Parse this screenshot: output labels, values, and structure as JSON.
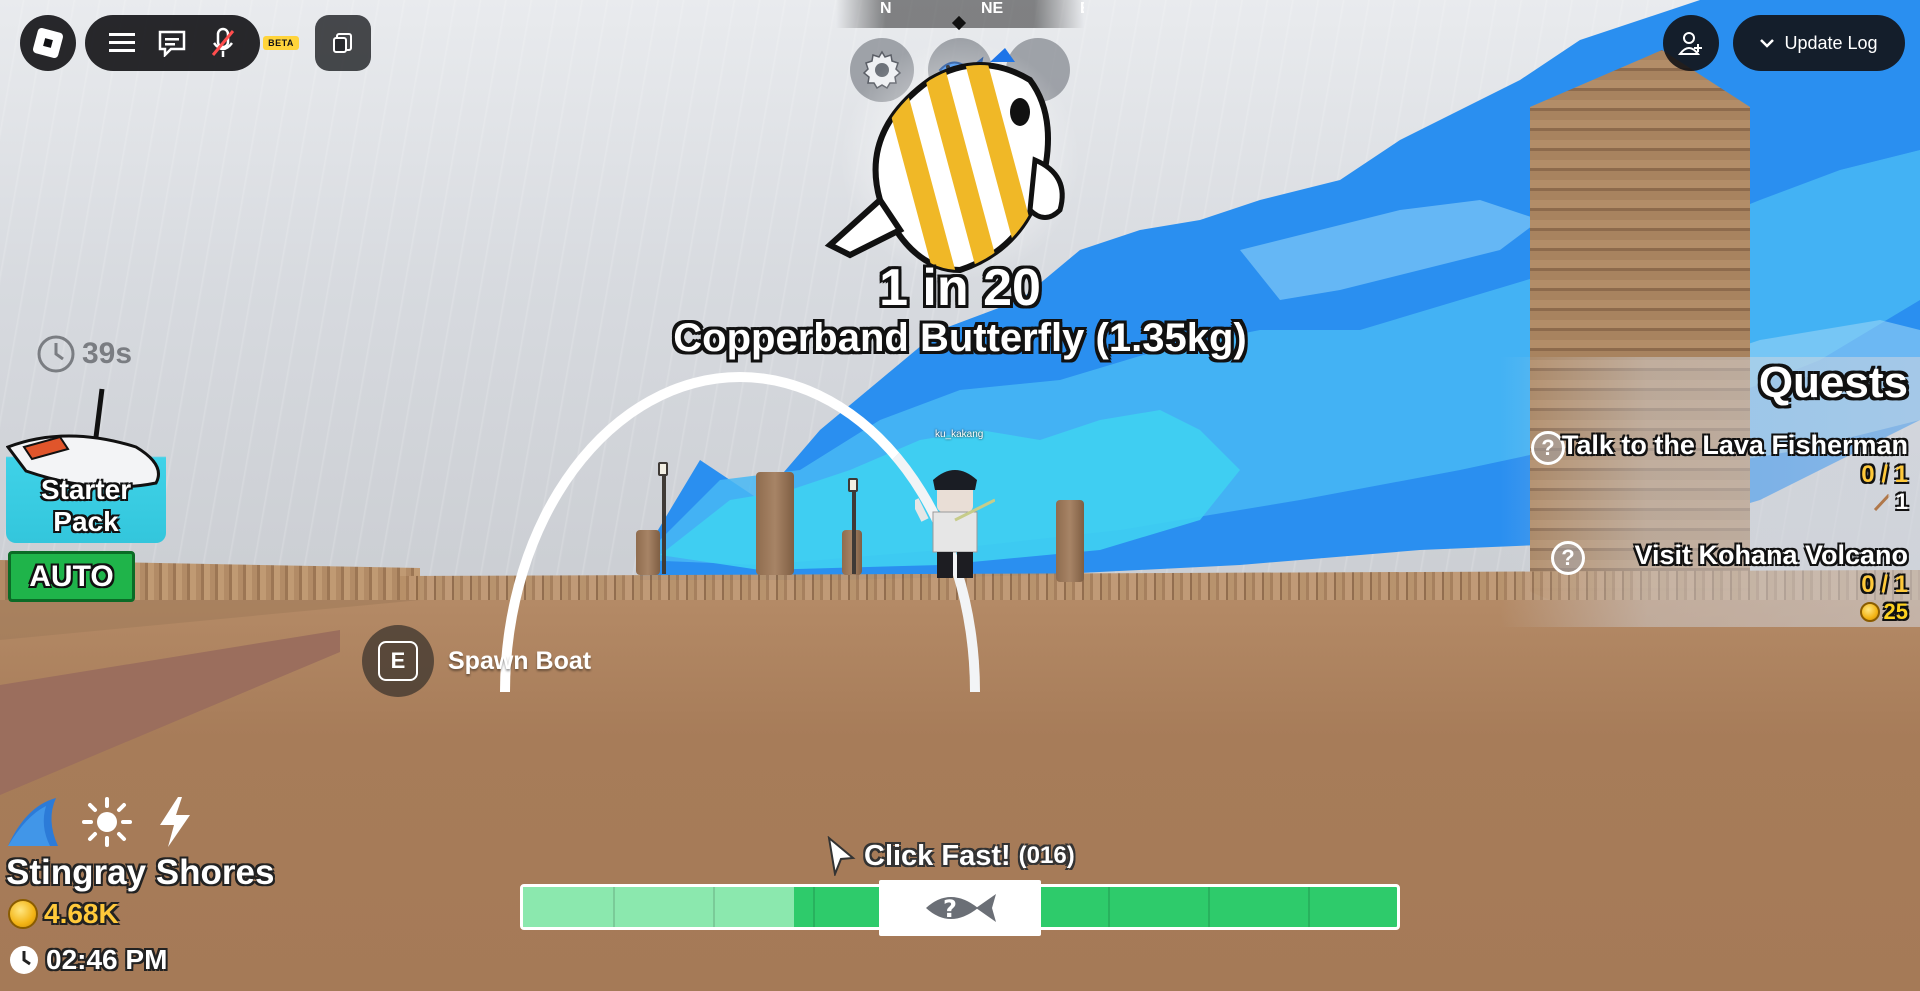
{
  "topbar": {
    "beta_label": "BETA",
    "update_log_label": "Update Log"
  },
  "compass": {
    "north": "N",
    "northeast": "NE",
    "east_partial": "E"
  },
  "catch": {
    "odds": "1 in 20",
    "fish_name": "Copperband Butterfly (1.35kg)"
  },
  "player": {
    "name": "ku_kakang"
  },
  "left_panel": {
    "timer": "39s",
    "starter_pack_label": "Starter Pack",
    "auto_label": "AUTO"
  },
  "prompt": {
    "key": "E",
    "label": "Spawn Boat"
  },
  "quests": {
    "title": "Quests",
    "items": [
      {
        "name": "Talk to the Lava Fisherman",
        "progress": "0 / 1",
        "reward": "1",
        "reward_icon": "fishing-rod-icon"
      },
      {
        "name": "Visit Kohana Volcano",
        "progress": "0 / 1",
        "reward": "25",
        "reward_icon": "coin-icon"
      }
    ]
  },
  "stats": {
    "area": "Stingray Shores",
    "coins": "4.68K",
    "time": "02:46 PM",
    "weather_icons": [
      "shark-fin-icon",
      "sun-icon",
      "lightning-icon"
    ]
  },
  "reel": {
    "instruction": "Click Fast!",
    "count": "(016)",
    "progress": 0.31,
    "fish_marker": "?"
  },
  "colors": {
    "reel_bar": "#2ecb6b",
    "reel_fill": "#8be8ae",
    "coin_text": "#ffc93a",
    "auto_button": "#1fb44a",
    "starter_pack": "#3fd2e8"
  }
}
